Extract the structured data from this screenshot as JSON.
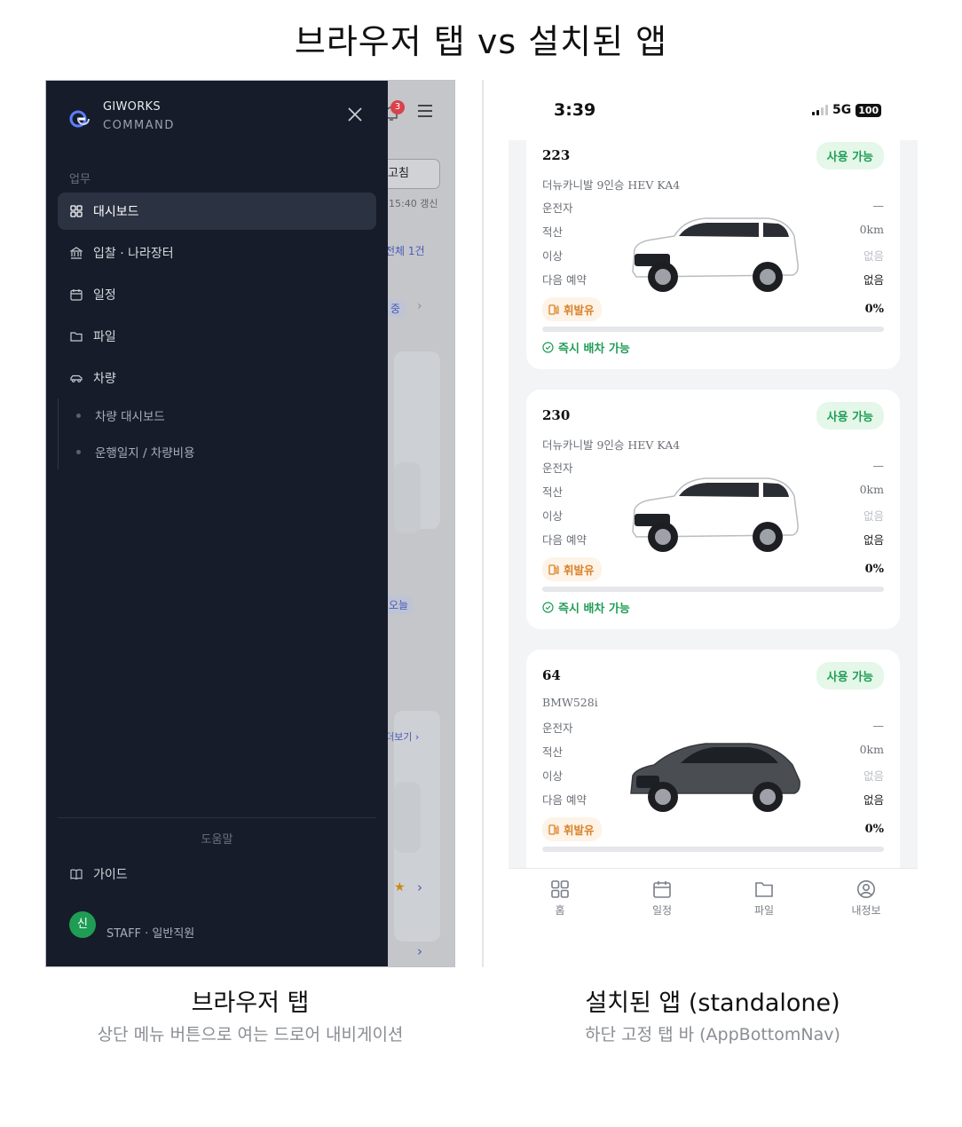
{
  "header": {
    "title": "브라우저 탭 vs 설치된 앱"
  },
  "browser": {
    "background": {
      "notification_count": "3",
      "refresh_label": "고침",
      "updated_text": "15:40 갱신",
      "total_text": "전체 1건",
      "status_chip": "중",
      "today_chip": "오늘",
      "more_link": "더보기 ›"
    },
    "drawer": {
      "brand_line1": "GIWORKS",
      "brand_line2": "COMMAND",
      "section_work": "업무",
      "items": [
        {
          "label": "대시보드",
          "icon": "grid-icon",
          "active": true
        },
        {
          "label": "입찰 · 나라장터",
          "icon": "bank-icon",
          "active": false
        },
        {
          "label": "일정",
          "icon": "calendar-icon",
          "active": false
        },
        {
          "label": "파일",
          "icon": "folder-icon",
          "active": false
        },
        {
          "label": "차량",
          "icon": "car-icon",
          "active": false
        }
      ],
      "sub_items": [
        {
          "label": "차량 대시보드"
        },
        {
          "label": "운행일지 / 차량비용"
        }
      ],
      "section_help": "도움말",
      "guide_label": "가이드",
      "user": {
        "avatar": "신",
        "role": "STAFF · 일반직원"
      }
    },
    "caption": {
      "title": "브라우저 탭",
      "subtitle": "상단 메뉴 버튼으로 여는 드로어 내비게이션"
    }
  },
  "app": {
    "status_bar": {
      "time": "3:39",
      "network": "5G",
      "battery": "100"
    },
    "vehicles": [
      {
        "plate": "223",
        "status": "사용 가능",
        "model": "더뉴카니발 9인승 HEV KA4",
        "rows": [
          {
            "label": "운전자",
            "value": "—"
          },
          {
            "label": "적산",
            "value": "0km"
          },
          {
            "label": "이상",
            "value": "없음"
          },
          {
            "label": "다음 예약",
            "value": "없음"
          }
        ],
        "fuel": "휘발유",
        "fuel_pct": "0%",
        "fuel_fraction": 0,
        "ready": "즉시 배차 가능",
        "car_color": "#ffffff"
      },
      {
        "plate": "230",
        "status": "사용 가능",
        "model": "더뉴카니발 9인승 HEV KA4",
        "rows": [
          {
            "label": "운전자",
            "value": "—"
          },
          {
            "label": "적산",
            "value": "0km"
          },
          {
            "label": "이상",
            "value": "없음"
          },
          {
            "label": "다음 예약",
            "value": "없음"
          }
        ],
        "fuel": "휘발유",
        "fuel_pct": "0%",
        "fuel_fraction": 0,
        "ready": "즉시 배차 가능",
        "car_color": "#ffffff"
      },
      {
        "plate": "64",
        "status": "사용 가능",
        "model": "BMW528i",
        "rows": [
          {
            "label": "운전자",
            "value": "—"
          },
          {
            "label": "적산",
            "value": "0km"
          },
          {
            "label": "이상",
            "value": "없음"
          },
          {
            "label": "다음 예약",
            "value": "없음"
          }
        ],
        "fuel": "휘발유",
        "fuel_pct": "0%",
        "fuel_fraction": 0,
        "car_color": "#4a4d52"
      }
    ],
    "tabs": [
      {
        "label": "홈",
        "icon": "grid-icon"
      },
      {
        "label": "일정",
        "icon": "calendar-icon"
      },
      {
        "label": "파일",
        "icon": "folder-icon"
      },
      {
        "label": "내정보",
        "icon": "user-icon"
      }
    ],
    "caption": {
      "title": "설치된 앱 (standalone)",
      "subtitle": "하단 고정 탭 바 (AppBottomNav)"
    }
  },
  "colors": {
    "drawer_bg": "#161c29",
    "accent_green": "#1f9d55",
    "fuel_orange": "#d9822b"
  }
}
